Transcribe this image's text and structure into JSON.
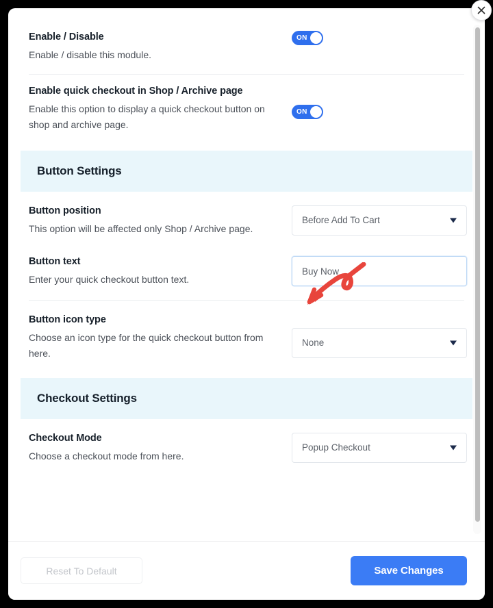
{
  "modal": {
    "close_icon": "close-icon",
    "scrollbar": "vertical-scrollbar"
  },
  "settings": [
    {
      "id": "enable-disable",
      "title": "Enable / Disable",
      "desc": "Enable / disable this module.",
      "control": "toggle",
      "toggle_label": "ON",
      "state": "on"
    },
    {
      "id": "enable-quick-checkout",
      "title": "Enable quick checkout in Shop / Archive page",
      "desc": "Enable this option to display a quick checkout button on shop and archive page.",
      "control": "toggle",
      "toggle_label": "ON",
      "state": "on"
    }
  ],
  "button_settings": {
    "header": "Button Settings",
    "position": {
      "title": "Button position",
      "desc": "This option will be affected only Shop / Archive page.",
      "control": "select",
      "value": "Before Add To Cart",
      "caret_icon": "chevron-down-icon"
    },
    "text": {
      "title": "Button text",
      "desc": "Enter your quick checkout button text.",
      "control": "input",
      "value": "Buy Now",
      "placeholder": "Buy Now"
    },
    "icon_type": {
      "title": "Button icon type",
      "desc": "Choose an icon type for the quick checkout button from here.",
      "control": "select",
      "value": "None",
      "caret_icon": "chevron-down-icon"
    }
  },
  "checkout_settings": {
    "header": "Checkout Settings",
    "mode": {
      "title": "Checkout Mode",
      "desc": "Choose a checkout mode from here.",
      "control": "select",
      "value": "Popup Checkout",
      "caret_icon": "chevron-down-icon"
    }
  },
  "footer": {
    "reset_label": "Reset To Default",
    "save_label": "Save Changes"
  },
  "annotation": {
    "type": "hand-drawn-arrow",
    "color": "#e8453c",
    "points_to": "button-text-input"
  },
  "colors": {
    "accent": "#3b7cf5",
    "toggle_on": "#2f6fed",
    "section_header_bg": "#e9f6fb",
    "annotation_red": "#e8453c",
    "caret": "#1b2a4a"
  }
}
